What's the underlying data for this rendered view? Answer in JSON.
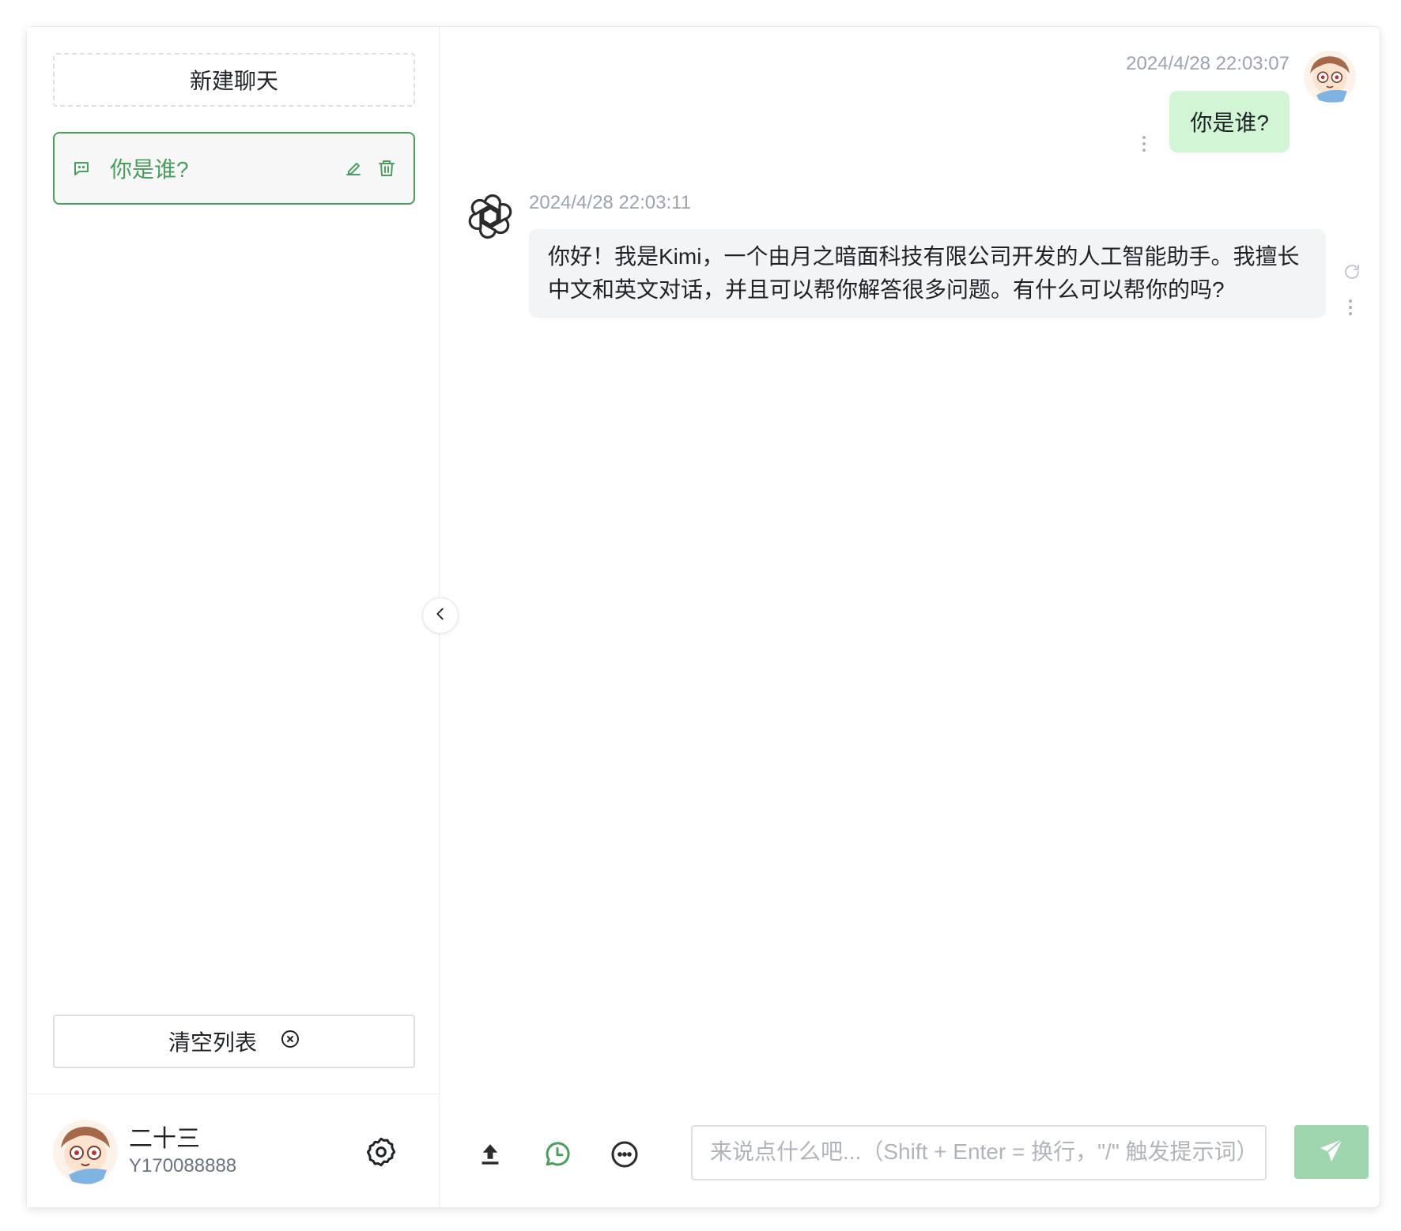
{
  "sidebar": {
    "new_chat_label": "新建聊天",
    "chats": [
      {
        "title": "你是谁?",
        "active": true
      }
    ],
    "clear_label": "清空列表",
    "user": {
      "name": "二十三",
      "id": "Y170088888"
    }
  },
  "messages": [
    {
      "role": "user",
      "time": "2024/4/28 22:03:07",
      "text": "你是谁?"
    },
    {
      "role": "assistant",
      "time": "2024/4/28 22:03:11",
      "text": "你好！我是Kimi，一个由月之暗面科技有限公司开发的人工智能助手。我擅长中文和英文对话，并且可以帮你解答很多问题。有什么可以帮你的吗?"
    }
  ],
  "composer": {
    "placeholder": "来说点什么吧...（Shift + Enter = 换行，\"/\" 触发提示词）"
  },
  "colors": {
    "accent": "#4b9e5f",
    "user_bubble": "#d2f5d5",
    "assistant_bubble": "#f3f4f6",
    "send_button": "#9fd6ad"
  },
  "icons": {
    "chat_item": "chat-bubble-icon",
    "edit": "pencil-icon",
    "delete": "trash-icon",
    "clear": "close-circle-icon",
    "settings": "gear-icon",
    "collapse": "chevron-left-icon",
    "upload": "upload-icon",
    "history": "clock-message-icon",
    "more": "more-circle-icon",
    "send": "send-icon",
    "assistant_avatar": "openai-logo-icon",
    "regenerate": "refresh-icon",
    "message_more": "vertical-dots-icon"
  }
}
